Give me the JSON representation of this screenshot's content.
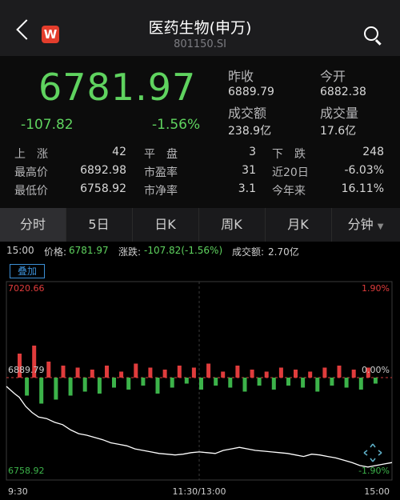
{
  "header": {
    "title": "医药生物(申万)",
    "code": "801150.SI",
    "logo_letter": "W"
  },
  "quote": {
    "price": "6781.97",
    "change": "-107.82",
    "change_pct": "-1.56%",
    "prev_close_label": "昨收",
    "prev_close": "6889.79",
    "open_label": "今开",
    "open": "6882.38",
    "turnover_label": "成交额",
    "turnover": "238.9亿",
    "volume_label": "成交量",
    "volume": "17.6亿",
    "stats": [
      [
        {
          "label": "上　涨",
          "value": "42"
        },
        {
          "label": "平　盘",
          "value": "3"
        },
        {
          "label": "下　跌",
          "value": "248"
        }
      ],
      [
        {
          "label": "最高价",
          "value": "6892.98"
        },
        {
          "label": "市盈率",
          "value": "31"
        },
        {
          "label": "近20日",
          "value": "-6.03%"
        }
      ],
      [
        {
          "label": "最低价",
          "value": "6758.92"
        },
        {
          "label": "市净率",
          "value": "3.1"
        },
        {
          "label": "今年来",
          "value": "16.11%"
        }
      ]
    ]
  },
  "tabs": [
    "分时",
    "5日",
    "日K",
    "周K",
    "月K",
    "分钟"
  ],
  "info": {
    "time": "15:00",
    "price_label": "价格:",
    "price": "6781.97",
    "change_label": "涨跌:",
    "change": "-107.82(-1.56%)",
    "turnover_label": "成交额:",
    "turnover": "2.70亿"
  },
  "overlay_label": "叠加",
  "chart": {
    "y_high": "7020.66",
    "y_mid": "6889.79",
    "y_low": "6758.92",
    "pct_high": "1.90%",
    "pct_mid": "0.00%",
    "pct_low": "-1.90%",
    "x_start": "9:30",
    "x_mid": "11:30/13:00",
    "x_end": "15:00",
    "colors": {
      "up": "#e03c3c",
      "down": "#3cb34a",
      "line": "#ffffff",
      "grid": "#3a3a3a"
    }
  },
  "chart_data": {
    "type": "line",
    "ylim": [
      6758.92,
      7020.66
    ],
    "baseline": 6889.79,
    "x": [
      0,
      5,
      8,
      12,
      16,
      20,
      25,
      30,
      35,
      40,
      45,
      50,
      55,
      60,
      65,
      70,
      75,
      80,
      85,
      90,
      95,
      100,
      105,
      110,
      115,
      120,
      125,
      130,
      135,
      140,
      145,
      150,
      155,
      160,
      165,
      170,
      175,
      180,
      185,
      190,
      195,
      200,
      205,
      210,
      215,
      220,
      225,
      230,
      235,
      240
    ],
    "price": [
      6882.4,
      6873,
      6868,
      6856,
      6848,
      6842,
      6840,
      6835,
      6832,
      6825,
      6820,
      6818,
      6815,
      6812,
      6808,
      6806,
      6804,
      6800,
      6798,
      6796,
      6794,
      6793,
      6792,
      6793,
      6795,
      6796,
      6795,
      6794,
      6798,
      6800,
      6802,
      6800,
      6798,
      6797,
      6796,
      6795,
      6794,
      6792,
      6790,
      6793,
      6792,
      6790,
      6788,
      6785,
      6782,
      6778,
      6776,
      6778,
      6780,
      6781.97
    ],
    "volume_bars": [
      1.2,
      -0.9,
      1.6,
      -1.3,
      0.8,
      -1.1,
      0.6,
      -0.9,
      0.5,
      -0.7,
      0.4,
      -0.8,
      0.6,
      -0.5,
      0.3,
      -0.6,
      0.7,
      -0.4,
      0.5,
      -0.8,
      0.4,
      -0.5,
      0.6,
      -0.3,
      0.5,
      -0.6,
      0.7,
      -0.4,
      0.3,
      -0.5,
      0.6,
      -0.7,
      0.4,
      -0.4,
      0.3,
      -0.6,
      0.5,
      -0.4,
      0.4,
      -0.5,
      0.3,
      -0.7,
      0.5,
      -0.4,
      0.6,
      -0.5,
      0.4,
      -0.6,
      0.5,
      -0.3
    ]
  }
}
